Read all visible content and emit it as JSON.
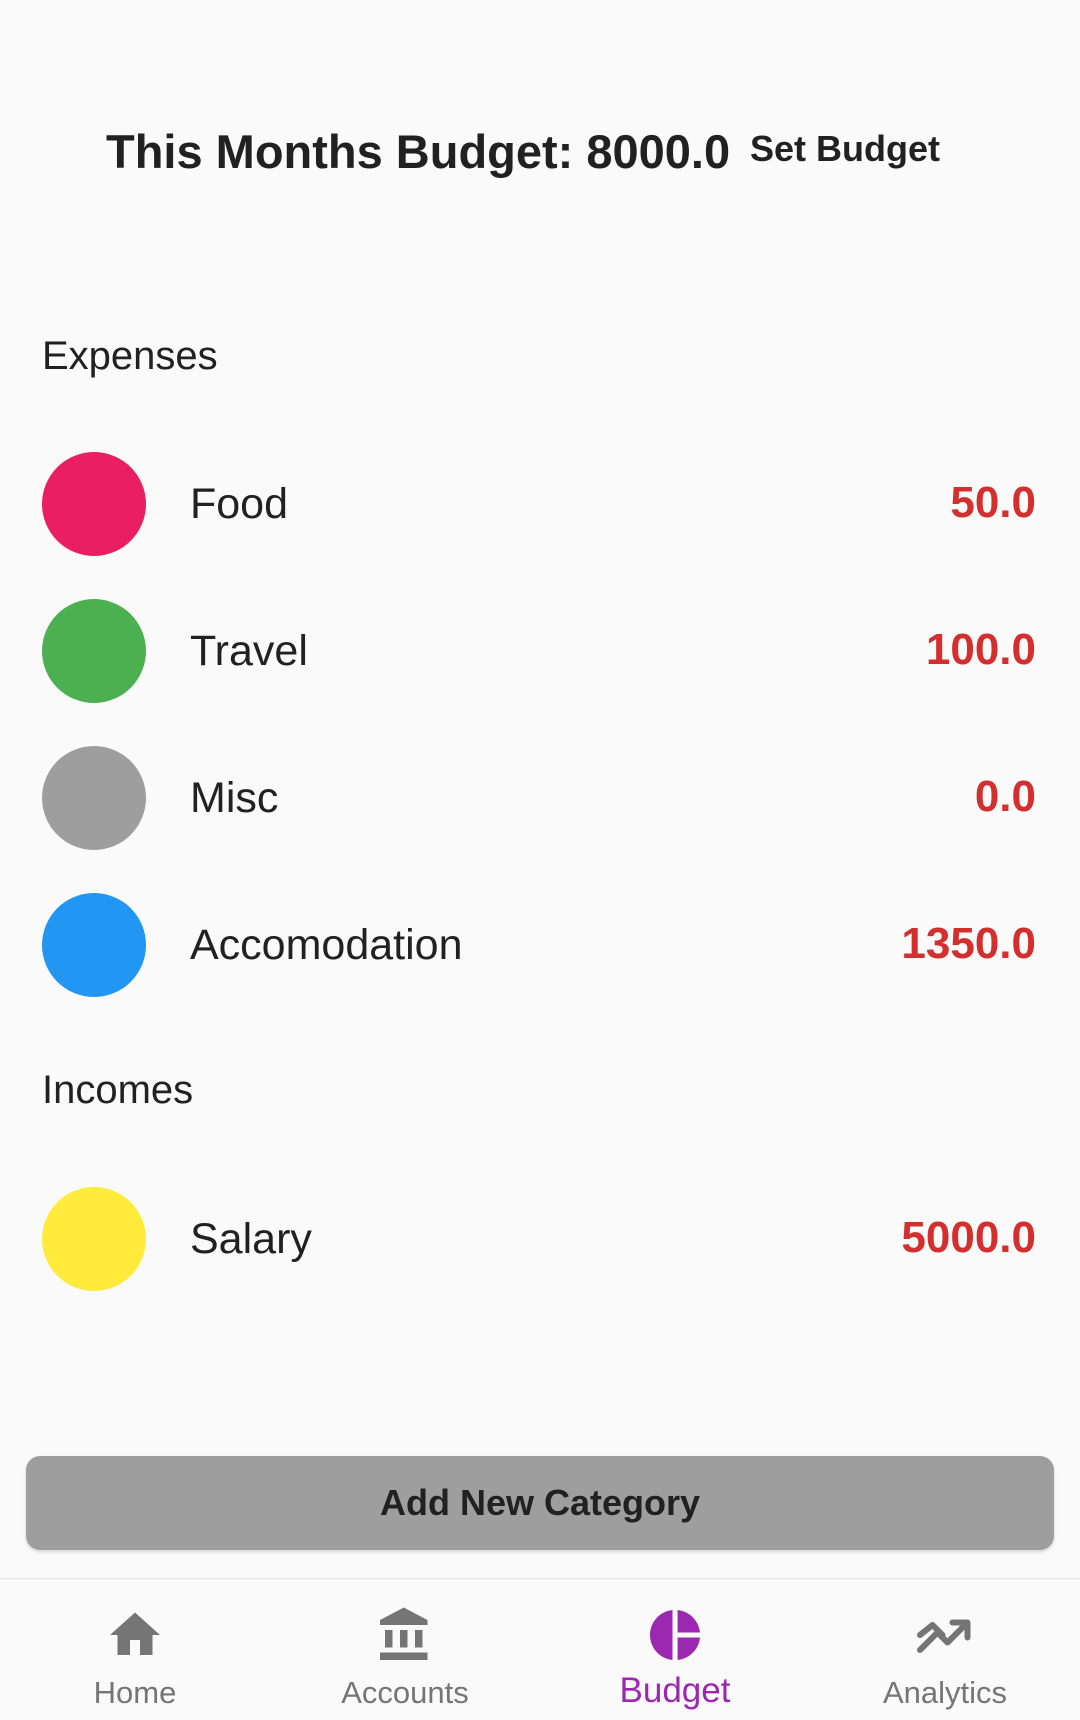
{
  "header": {
    "budget_title": "This Months Budget: 8000.0",
    "set_budget_label": "Set Budget"
  },
  "expenses": {
    "title": "Expenses",
    "items": [
      {
        "label": "Food",
        "amount": "50.0",
        "color": "#e91e63"
      },
      {
        "label": "Travel",
        "amount": "100.0",
        "color": "#4caf50"
      },
      {
        "label": "Misc",
        "amount": "0.0",
        "color": "#9e9e9e"
      },
      {
        "label": "Accomodation",
        "amount": "1350.0",
        "color": "#2196f3"
      }
    ]
  },
  "incomes": {
    "title": "Incomes",
    "items": [
      {
        "label": "Salary",
        "amount": "5000.0",
        "color": "#ffeb3b"
      }
    ]
  },
  "add_button_label": "Add New Category",
  "nav": {
    "active_color": "#9c27b0",
    "inactive_color": "#757575",
    "items": [
      {
        "label": "Home",
        "icon": "home-icon"
      },
      {
        "label": "Accounts",
        "icon": "bank-icon"
      },
      {
        "label": "Budget",
        "icon": "pie-chart-icon"
      },
      {
        "label": "Analytics",
        "icon": "trending-icon"
      }
    ],
    "active_index": 2
  },
  "amount_color": "#d32f2f"
}
